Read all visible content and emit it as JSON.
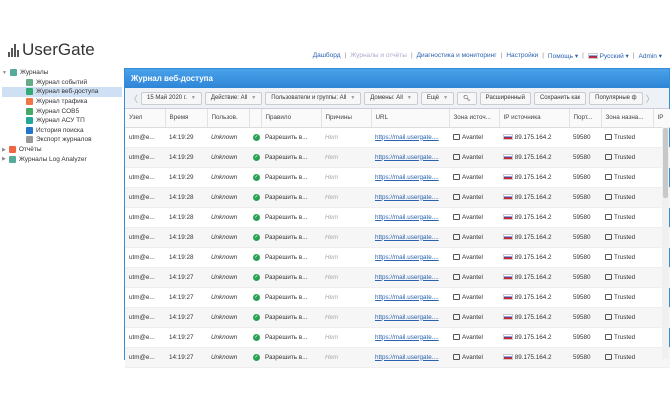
{
  "logo": "UserGate",
  "topnav": [
    {
      "label": "Дашборд"
    },
    {
      "label": "Журналы и отчёты",
      "dim": true
    },
    {
      "label": "Диагностика и мониторинг"
    },
    {
      "label": "Настройки"
    },
    {
      "label": "Помощь ▾"
    },
    {
      "label": "Русский ▾",
      "flag": true
    },
    {
      "label": "Admin ▾"
    }
  ],
  "tree": [
    {
      "label": "Журналы",
      "lvl": 0,
      "color": "#5a9"
    },
    {
      "label": "Журнал событий",
      "lvl": 1,
      "color": "#6a8"
    },
    {
      "label": "Журнал веб-доступа",
      "lvl": 1,
      "color": "#3a7",
      "sel": true
    },
    {
      "label": "Журнал трафика",
      "lvl": 1,
      "color": "#e74"
    },
    {
      "label": "Журнал СОВ5",
      "lvl": 1,
      "color": "#4a6"
    },
    {
      "label": "Журнал АСУ ТП",
      "lvl": 1,
      "color": "#2a9"
    },
    {
      "label": "История поиска",
      "lvl": 1,
      "color": "#27c"
    },
    {
      "label": "Экспорт журналов",
      "lvl": 1,
      "color": "#999"
    },
    {
      "label": "Отчёты",
      "lvl": 0,
      "color": "#e64"
    },
    {
      "label": "Журналы Log Analyzer",
      "lvl": 0,
      "color": "#5a9"
    }
  ],
  "panel": {
    "title": "Журнал веб-доступа"
  },
  "toolbar": {
    "date": "15 Май 2020 г.",
    "action": "Действие: All",
    "users": "Пользователи и группы: All",
    "domains": "Домены: All",
    "more": "Ещё",
    "advanced": "Расширенный",
    "save_as": "Сохранить как",
    "popular": "Популярные ф"
  },
  "columns": [
    "Узел",
    "Время",
    "Пользов.",
    "",
    "Правило",
    "Причины",
    "URL",
    "Зона источ...",
    "IP источника",
    "Порт...",
    "Зона назна...",
    "IP"
  ],
  "rows": [
    {
      "node": "utm@e...",
      "time": "14:19:29",
      "user": "Unknown",
      "rule": "Разрешить в...",
      "reason": "Нет",
      "url": "https://mail.usergate....",
      "src_zone": "Avantel",
      "src_ip": "89.175.164.2",
      "port": "59580",
      "dst_zone": "Trusted"
    },
    {
      "node": "utm@e...",
      "time": "14:19:29",
      "user": "Unknown",
      "rule": "Разрешить в...",
      "reason": "Нет",
      "url": "https://mail.usergate....",
      "src_zone": "Avantel",
      "src_ip": "89.175.164.2",
      "port": "59580",
      "dst_zone": "Trusted"
    },
    {
      "node": "utm@e...",
      "time": "14:19:29",
      "user": "Unknown",
      "rule": "Разрешить в...",
      "reason": "Нет",
      "url": "https://mail.usergate....",
      "src_zone": "Avantel",
      "src_ip": "89.175.164.2",
      "port": "59580",
      "dst_zone": "Trusted"
    },
    {
      "node": "utm@e...",
      "time": "14:19:28",
      "user": "Unknown",
      "rule": "Разрешить в...",
      "reason": "Нет",
      "url": "https://mail.usergate....",
      "src_zone": "Avantel",
      "src_ip": "89.175.164.2",
      "port": "59580",
      "dst_zone": "Trusted"
    },
    {
      "node": "utm@e...",
      "time": "14:19:28",
      "user": "Unknown",
      "rule": "Разрешить в...",
      "reason": "Нет",
      "url": "https://mail.usergate....",
      "src_zone": "Avantel",
      "src_ip": "89.175.164.2",
      "port": "59580",
      "dst_zone": "Trusted"
    },
    {
      "node": "utm@e...",
      "time": "14:19:28",
      "user": "Unknown",
      "rule": "Разрешить в...",
      "reason": "Нет",
      "url": "https://mail.usergate....",
      "src_zone": "Avantel",
      "src_ip": "89.175.164.2",
      "port": "59580",
      "dst_zone": "Trusted"
    },
    {
      "node": "utm@e...",
      "time": "14:19:28",
      "user": "Unknown",
      "rule": "Разрешить в...",
      "reason": "Нет",
      "url": "https://mail.usergate....",
      "src_zone": "Avantel",
      "src_ip": "89.175.164.2",
      "port": "59580",
      "dst_zone": "Trusted"
    },
    {
      "node": "utm@e...",
      "time": "14:19:27",
      "user": "Unknown",
      "rule": "Разрешить в...",
      "reason": "Нет",
      "url": "https://mail.usergate....",
      "src_zone": "Avantel",
      "src_ip": "89.175.164.2",
      "port": "59580",
      "dst_zone": "Trusted"
    },
    {
      "node": "utm@e...",
      "time": "14:19:27",
      "user": "Unknown",
      "rule": "Разрешить в...",
      "reason": "Нет",
      "url": "https://mail.usergate....",
      "src_zone": "Avantel",
      "src_ip": "89.175.164.2",
      "port": "59580",
      "dst_zone": "Trusted"
    },
    {
      "node": "utm@e...",
      "time": "14:19:27",
      "user": "Unknown",
      "rule": "Разрешить в...",
      "reason": "Нет",
      "url": "https://mail.usergate....",
      "src_zone": "Avantel",
      "src_ip": "89.175.164.2",
      "port": "59580",
      "dst_zone": "Trusted"
    },
    {
      "node": "utm@e...",
      "time": "14:19:27",
      "user": "Unknown",
      "rule": "Разрешить в...",
      "reason": "Нет",
      "url": "https://mail.usergate....",
      "src_zone": "Avantel",
      "src_ip": "89.175.164.2",
      "port": "59580",
      "dst_zone": "Trusted"
    },
    {
      "node": "utm@e...",
      "time": "14:19:27",
      "user": "Unknown",
      "rule": "Разрешить в...",
      "reason": "Нет",
      "url": "https://mail.usergate....",
      "src_zone": "Avantel",
      "src_ip": "89.175.164.2",
      "port": "59580",
      "dst_zone": "Trusted"
    }
  ]
}
